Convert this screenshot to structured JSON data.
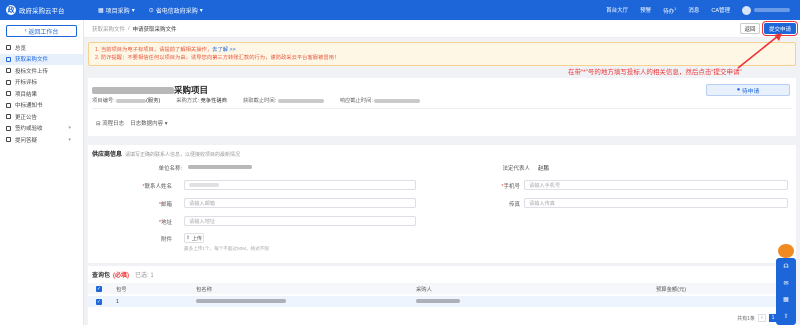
{
  "topbar": {
    "app_title": "政府采购云平台",
    "project_menu": "项目采购",
    "region": "省电信政府采购",
    "links": [
      "首台大厅",
      "预警",
      "待办",
      "消息",
      "CA管理"
    ],
    "todo_badge": "1"
  },
  "sidebar": {
    "workspace_button": "返回工作台",
    "items": [
      {
        "label": "总览",
        "icon": "overview-icon",
        "chevron": false
      },
      {
        "label": "获取采购文件",
        "icon": "document-icon",
        "chevron": false
      },
      {
        "label": "投标文件上传",
        "icon": "upload-icon",
        "chevron": false
      },
      {
        "label": "开标评标",
        "icon": "bid-icon",
        "chevron": false
      },
      {
        "label": "项目结果",
        "icon": "result-icon",
        "chevron": false
      },
      {
        "label": "中标通知书",
        "icon": "notice-icon",
        "chevron": false
      },
      {
        "label": "更正公告",
        "icon": "announcement-icon",
        "chevron": false
      },
      {
        "label": "签约或验收",
        "icon": "contract-icon",
        "chevron": true
      },
      {
        "label": "提问答疑",
        "icon": "question-icon",
        "chevron": true
      }
    ]
  },
  "breadcrumb": {
    "parent": "获取采购文件",
    "separator": "/",
    "current": "申请获取采购文件"
  },
  "header_buttons": {
    "back": "返回",
    "submit": "提交申请"
  },
  "notice": {
    "line1": "1. 当前项目为电子标项目，请提前了解相关操作，",
    "line1_link": "去了解 >>",
    "line2": "2. 防诈提醒：不要相信任何以项目为由，诱导您向第三方转账汇款的行为，谨防政采云平台客服被冒用！"
  },
  "annotation": "在带“*”号的地方填写投标人的相关信息，然后点击“提交申请”",
  "project": {
    "title": "采购项目",
    "meta": [
      {
        "label": "项目编号:",
        "value": "(服务)"
      },
      {
        "label": "采购方式:",
        "value": "竞争性磋商"
      },
      {
        "label": "获取截止时间:",
        "value": ""
      },
      {
        "label": "响应截止时间:",
        "value": ""
      }
    ],
    "tag_button": "待申请",
    "tabs": [
      "流程日志",
      "日志数据内容"
    ]
  },
  "form": {
    "title": "供应商信息",
    "subtitle": "请填写正确的联系人信息，以便接收项目的最新情况",
    "company_label": "单位名称:",
    "company_value": "",
    "legal_label": "法定代表人",
    "legal_value": "赵鹏",
    "contact_label": "联系人姓名",
    "contact_placeholder": "",
    "phone_label": "手机号",
    "phone_placeholder": "请输入手机号",
    "email_label": "邮箱",
    "email_placeholder": "请输入邮箱",
    "fax_label": "传真",
    "fax_placeholder": "请输入传真",
    "address_label": "地址",
    "address_placeholder": "请输入地址",
    "attach_label": "附件",
    "upload_button": "上传",
    "upload_hint": "最多上传1个，每个不超过50M，格式不限"
  },
  "package": {
    "title": "查询包",
    "required": "(必填)",
    "count": "已选: 1",
    "columns": [
      "包号",
      "包名称",
      "采购人",
      "预算金额(元)"
    ],
    "rows": [
      {
        "no": "1",
        "name": "",
        "buyer": "",
        "budget": ""
      }
    ]
  },
  "pager": {
    "total": "共有1条",
    "current": "1"
  },
  "colors": {
    "primary": "#1c66d9",
    "warning": "#e4573c",
    "annotation": "#e33333"
  }
}
